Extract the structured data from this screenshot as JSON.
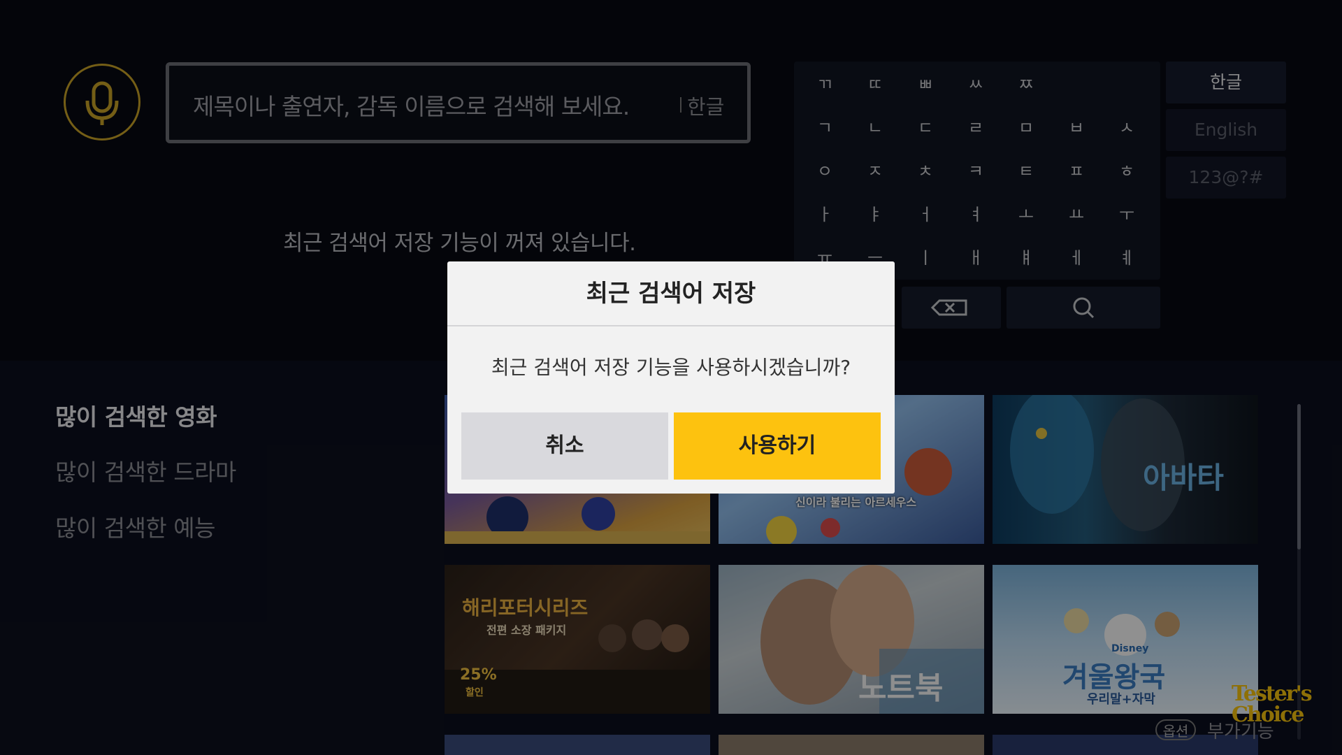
{
  "colors": {
    "accent_gold": "#c9a227",
    "confirm_button": "#fdc20f",
    "cancel_button": "#d9d9dd",
    "background": "#070912"
  },
  "search": {
    "placeholder": "제목이나 출연자, 감독 이름으로 검색해 보세요.",
    "input_lang": "한글",
    "mic_icon": "microphone-icon"
  },
  "notice": "최근 검색어 저장 기능이 꺼져 있습니다.",
  "keyboard": {
    "rows": [
      [
        "ㄲ",
        "ㄸ",
        "ㅃ",
        "ㅆ",
        "ㅉ"
      ],
      [
        "ㄱ",
        "ㄴ",
        "ㄷ",
        "ㄹ",
        "ㅁ",
        "ㅂ",
        "ㅅ"
      ],
      [
        "ㅇ",
        "ㅈ",
        "ㅊ",
        "ㅋ",
        "ㅌ",
        "ㅍ",
        "ㅎ"
      ],
      [
        "ㅏ",
        "ㅑ",
        "ㅓ",
        "ㅕ",
        "ㅗ",
        "ㅛ",
        "ㅜ"
      ],
      [
        "ㅠ",
        "ㅡ",
        "ㅣ",
        "ㅐ",
        "ㅒ",
        "ㅔ",
        "ㅖ"
      ]
    ],
    "backspace_icon": "backspace-icon",
    "search_icon": "search-icon",
    "modes": [
      "한글",
      "English",
      "123@?#"
    ],
    "active_mode": "한글"
  },
  "categories": [
    {
      "label": "많이 검색한 영화",
      "active": true
    },
    {
      "label": "많이 검색한 드라마",
      "active": false
    },
    {
      "label": "많이 검색한 예능",
      "active": false
    }
  ],
  "posters": [
    {
      "title": "",
      "caption": ""
    },
    {
      "title": "",
      "caption": "신이라 불리는 아르세우스"
    },
    {
      "title": "아바타",
      "caption": ""
    },
    {
      "title": "해리포터시리즈",
      "caption": "전편 소장 패키지",
      "badge": "25%",
      "badge_sub": "할인"
    },
    {
      "title": "노트북",
      "caption": ""
    },
    {
      "title": "겨울왕국",
      "caption": "우리말+자막",
      "brand": "Disney"
    }
  ],
  "footer": {
    "option_badge": "옵션",
    "option_label": "부가기능",
    "watermark_line1": "Tester's",
    "watermark_line2": "Choice"
  },
  "dialog": {
    "title": "최근 검색어 저장",
    "message": "최근 검색어 저장 기능을 사용하시겠습니까?",
    "cancel_label": "취소",
    "confirm_label": "사용하기"
  }
}
